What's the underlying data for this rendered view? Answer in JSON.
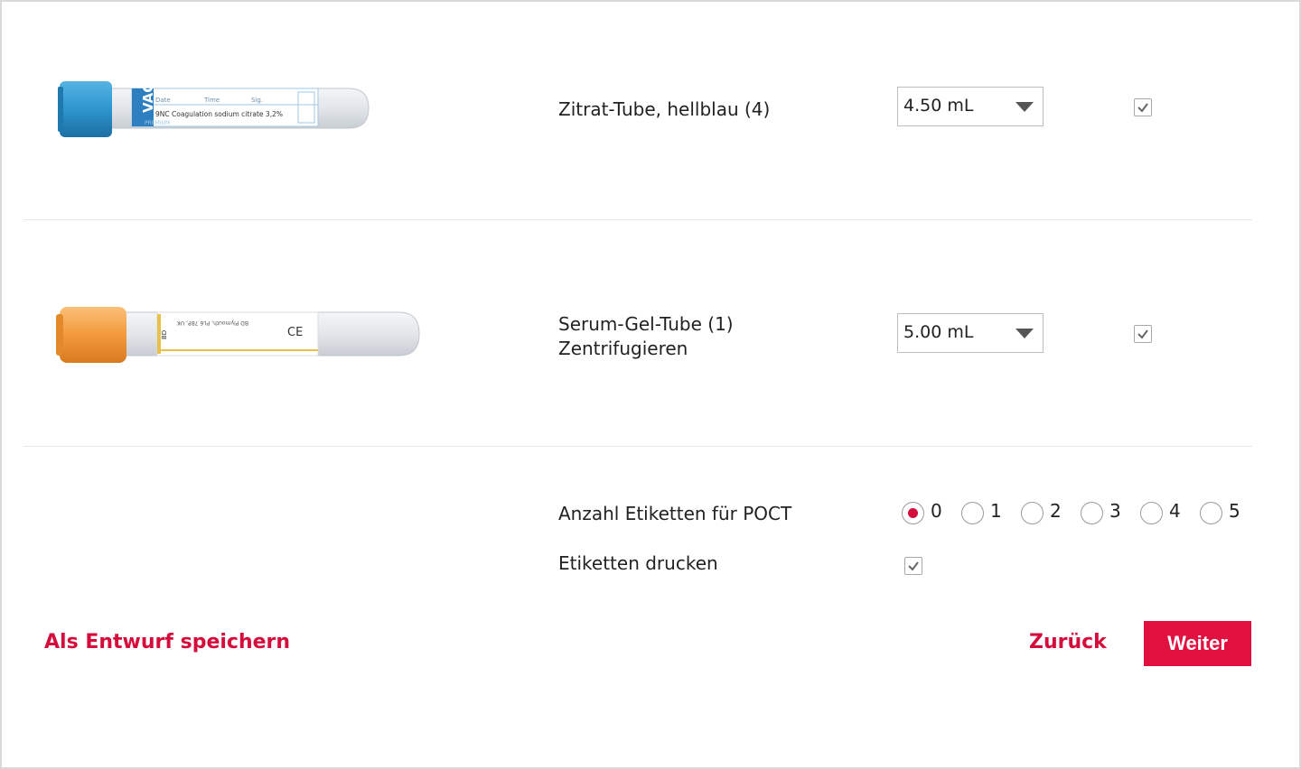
{
  "tubes": [
    {
      "name": "Zitrat-Tube, hellblau (4)",
      "subtitle": "",
      "volume": "4.50 mL",
      "selected": true,
      "cap_color": "#2e95cf",
      "tube_image": {
        "brand_text": "VAC",
        "col_date": "Date",
        "col_time": "Time",
        "col_sig": "Sig.",
        "main_text": "9NC Coagulation sodium citrate 3,2%",
        "premium_text": "PREMIUM"
      }
    },
    {
      "name": "Serum-Gel-Tube (1)",
      "subtitle": "Zentrifugieren",
      "volume": "5.00 mL",
      "selected": true,
      "cap_color": "#f39a3c",
      "tube_image": {
        "brand_text": "BD",
        "main_text": "BD Plymouth, PL6 7BP, UK",
        "ce_text": "CE"
      }
    }
  ],
  "poct": {
    "label": "Anzahl Etiketten für POCT",
    "options": [
      "0",
      "1",
      "2",
      "3",
      "4",
      "5"
    ],
    "selected": "0"
  },
  "print_labels": {
    "label": "Etiketten drucken",
    "checked": true
  },
  "actions": {
    "save_draft": "Als Entwurf speichern",
    "back": "Zurück",
    "next": "Weiter"
  },
  "colors": {
    "accent": "#d50c3b",
    "button_bg": "#e0103f"
  }
}
